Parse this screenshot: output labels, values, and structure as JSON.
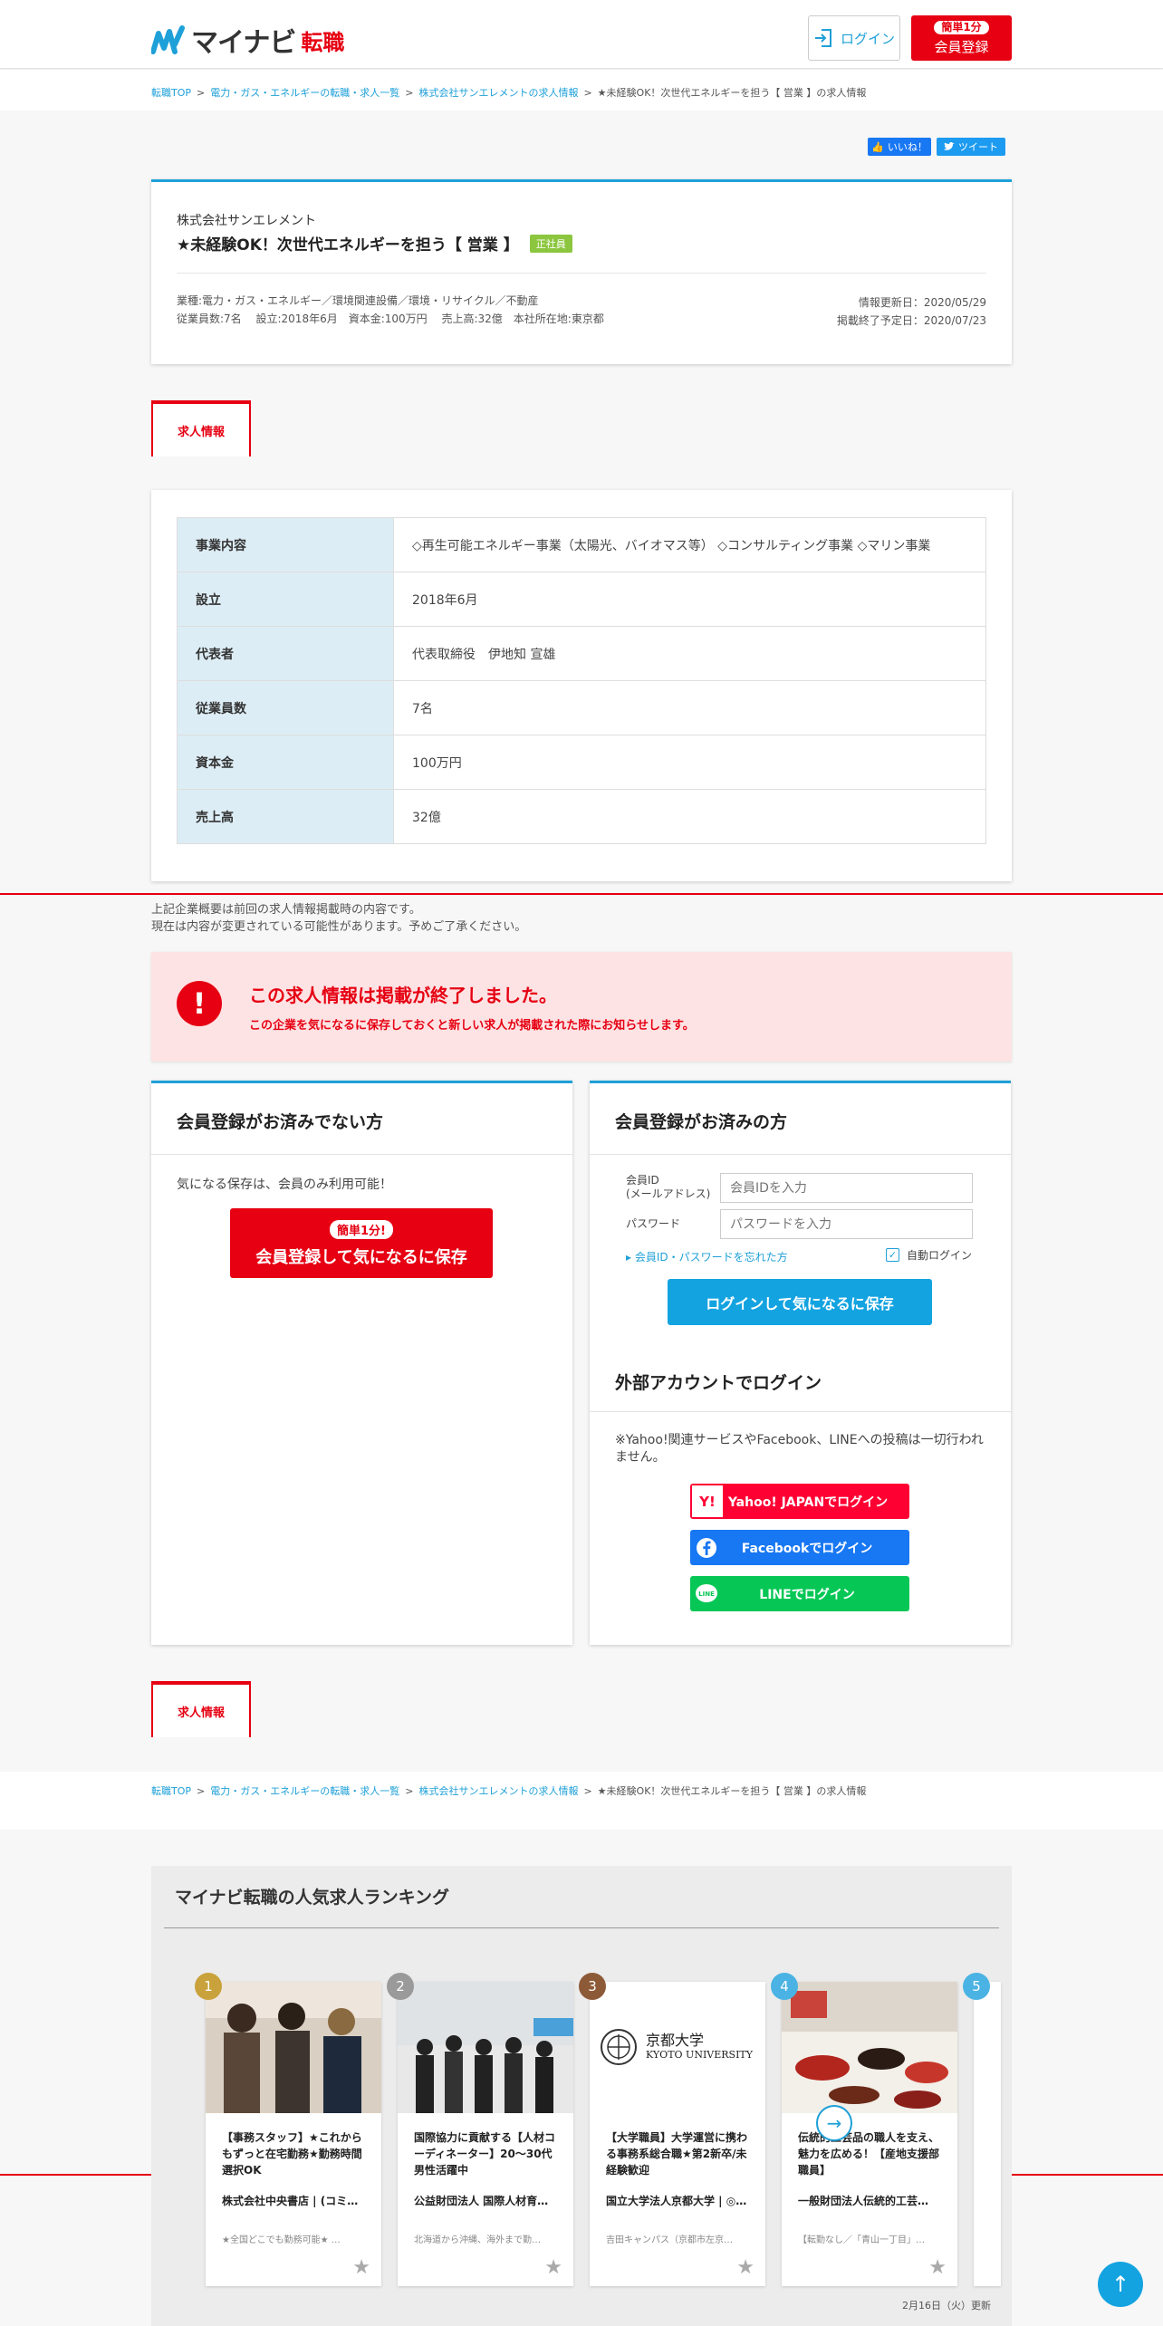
{
  "header": {
    "logo_text": "マイナビ",
    "logo_suffix": "転職",
    "login_label": "ログイン",
    "register_badge": "簡単1分",
    "register_label": "会員登録"
  },
  "breadcrumb": {
    "items": [
      "転職TOP",
      "電力・ガス・エネルギーの転職・求人一覧",
      "株式会社サンエレメントの求人情報"
    ],
    "current": "★未経験OK！次世代エネルギーを担う【 営業 】の求人情報",
    "separator": ">"
  },
  "social": {
    "like": "いいね！",
    "tweet": "ツイート"
  },
  "job": {
    "company": "株式会社サンエレメント",
    "title": "★未経験OK！次世代エネルギーを担う【 営業 】",
    "tag": "正社員",
    "industry": "業種:電力・ガス・エネルギー／環境関連設備／環境・リサイクル／不動産",
    "overview": "従業員数:7名　 設立:2018年6月　資本金:100万円　 売上高:32億　本社所在地:東京都",
    "updated": "情報更新日：2020/05/29",
    "end_date": "掲載終了予定日：2020/07/23"
  },
  "tab": {
    "label": "求人情報"
  },
  "company_table": [
    {
      "label": "事業内容",
      "value": "◇再生可能エネルギー事業（太陽光、バイオマス等） ◇コンサルティング事業 ◇マリン事業"
    },
    {
      "label": "設立",
      "value": "2018年6月"
    },
    {
      "label": "代表者",
      "value": "代表取締役　伊地知 宣雄"
    },
    {
      "label": "従業員数",
      "value": "7名"
    },
    {
      "label": "資本金",
      "value": "100万円"
    },
    {
      "label": "売上高",
      "value": "32億"
    }
  ],
  "notes": {
    "line1": "上記企業概要は前回の求人情報掲載時の内容です。",
    "line2": "現在は内容が変更されている可能性があります。予めご了承ください。"
  },
  "alert": {
    "icon": "!",
    "title": "この求人情報は掲載が終了しました。",
    "subtitle": "この企業を気になるに保存しておくと新しい求人が掲載された際にお知らせします。"
  },
  "panel_guest": {
    "heading": "会員登録がお済みでない方",
    "note": "気になる保存は、会員のみ利用可能！",
    "button_badge": "簡単1分!",
    "button_label": "会員登録して気になるに保存"
  },
  "panel_member": {
    "heading": "会員登録がお済みの方",
    "id_label_1": "会員ID",
    "id_label_2": "(メールアドレス)",
    "id_placeholder": "会員IDを入力",
    "password_label": "パスワード",
    "password_placeholder": "パスワードを入力",
    "forgot": "▸ 会員ID・パスワードを忘れた方",
    "auto_login": "自動ログイン",
    "auto_login_checked": true,
    "login_button": "ログインして気になるに保存",
    "external_heading": "外部アカウントでログイン",
    "external_note": "※Yahoo!関連サービスやFacebook、LINEへの投稿は一切行われません。",
    "yahoo": "Yahoo! JAPANでログイン",
    "facebook": "Facebookでログイン",
    "line": "LINEでログイン"
  },
  "ranking": {
    "title": "マイナビ転職の人気求人ランキング",
    "updated": "2月16日（火）更新",
    "items": [
      {
        "rank": "1",
        "title": "【事務スタッフ】★これからもずっと在宅勤務★勤務時間選択OK",
        "company": "株式会社中央書店 | (コミ…",
        "location": "★全国どこでも勤務可能★ …",
        "color": "#c9a23c"
      },
      {
        "rank": "2",
        "title": "国際協力に貢献する【人材コーディネーター】20～30代男性活躍中",
        "company": "公益財団法人 国際人材育…",
        "location": "北海道から沖縄、海外まで勤…",
        "color": "#9a9a9a"
      },
      {
        "rank": "3",
        "title": "【大学職員】大学運営に携わる事務系総合職★第2新卒/未経験歓迎",
        "company": "国立大学法人京都大学 | ◎…",
        "location": "吉田キャンパス（京都市左京…",
        "color": "#8d5a38"
      },
      {
        "rank": "4",
        "title": "伝統的工芸品の職人を支え、魅力を広める！【産地支援部職員】",
        "company": "一般財団法人伝統的工芸…",
        "location": "【転勤なし／「青山一丁目」…",
        "color": "#4bb3e3"
      },
      {
        "rank": "5",
        "title": "",
        "company": "",
        "location": "",
        "color": "#4bb3e3"
      }
    ],
    "university_name_jp": "京都大学",
    "university_name_en": "KYOTO UNIVERSITY"
  }
}
